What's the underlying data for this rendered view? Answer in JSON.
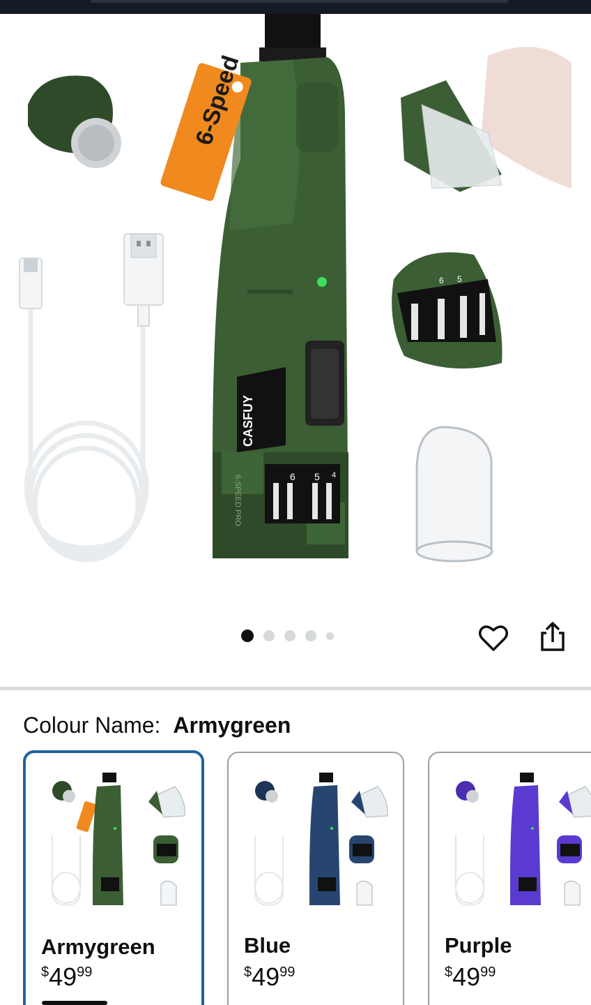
{
  "hero": {
    "tag_text": "6-Speed",
    "brand_text": "CASFUY",
    "brand_sub": "SPEED CONTROL",
    "side_text": "6-SPEED PRO",
    "dial_numbers": [
      "6",
      "5",
      "4"
    ],
    "inset_dial_numbers": [
      "6",
      "5"
    ],
    "indicator_color": "#3be05a",
    "body_color": "#3b5e34",
    "tag_color": "#f08a1f"
  },
  "carousel": {
    "total": 5,
    "active": 1
  },
  "colour": {
    "label": "Colour Name:",
    "value": "Armygreen"
  },
  "swatches": [
    {
      "name": "Armygreen",
      "currency": "$",
      "whole": "49",
      "fraction": "99",
      "color": "#3b5e34",
      "selected": true
    },
    {
      "name": "Blue",
      "currency": "$",
      "whole": "49",
      "fraction": "99",
      "color": "#27466f",
      "selected": false
    },
    {
      "name": "Purple",
      "currency": "$",
      "whole": "49",
      "fraction": "99",
      "color": "#5a3ad1",
      "selected": false
    }
  ],
  "icons": {
    "wishlist": "heart-icon",
    "share": "share-icon"
  },
  "colors": {
    "selected_border": "#2162a1",
    "top_bar": "#141b24"
  }
}
